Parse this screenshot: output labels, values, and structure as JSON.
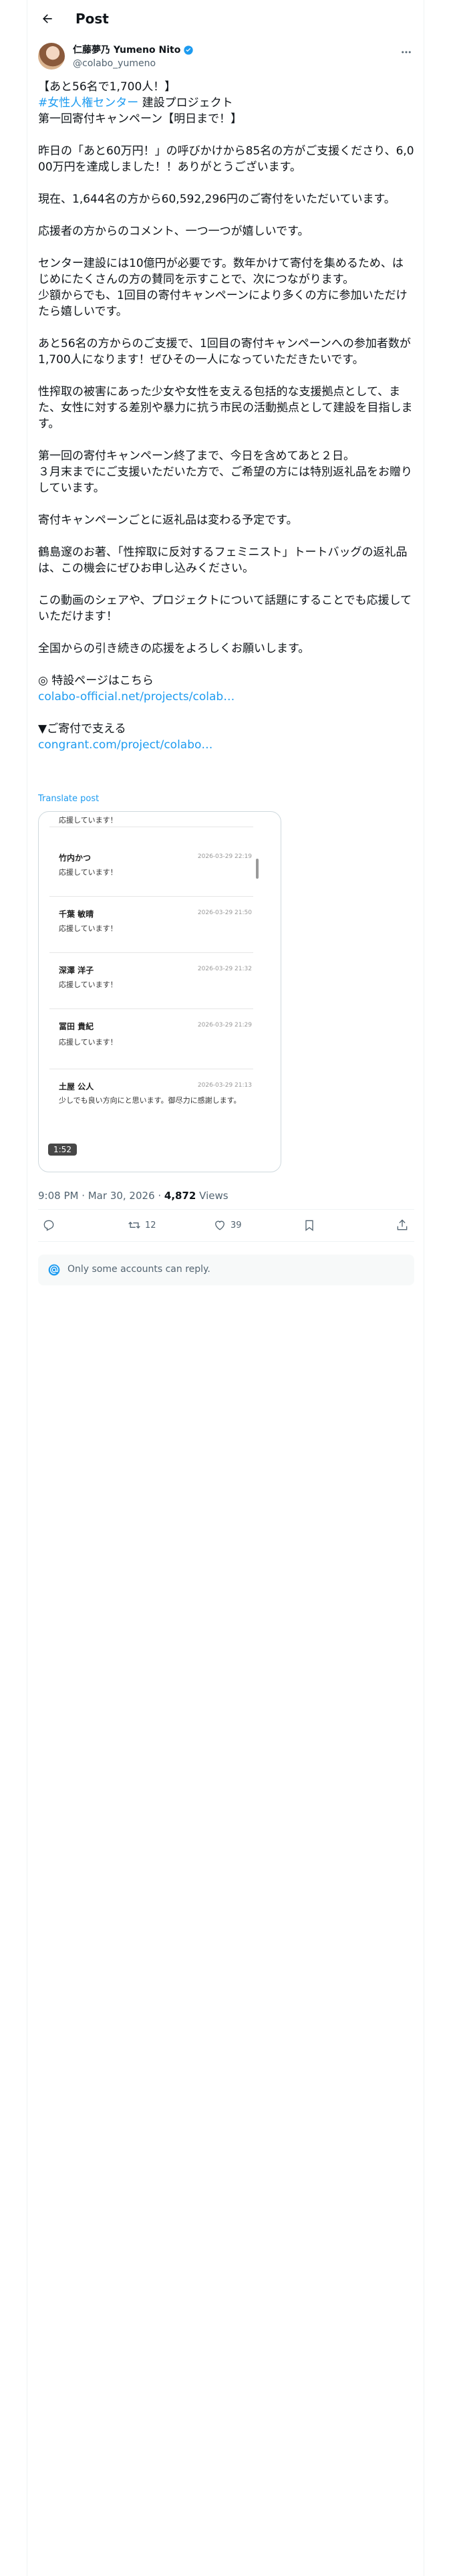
{
  "header": {
    "title": "Post"
  },
  "author": {
    "display_name": "仁藤夢乃 Yumeno Nito",
    "handle": "@colabo_yumeno"
  },
  "post": {
    "lines": [
      "【あと56名で1,700人！】",
      "#女性人権センター",
      " 建設プロジェクト",
      "第一回寄付キャンペーン【明日まで！】",
      "昨日の「あと60万円！」の呼びかけから85名の方がご支援くださり、6,000万円を達成しました！！ありがとうございます。",
      "現在、1,644名の方から60,592,296円のご寄付をいただいています。",
      "応援者の方からのコメント、一つ一つが嬉しいです。",
      "センター建設には10億円が必要です。数年かけて寄付を集めるため、はじめにたくさんの方の賛同を示すことで、次につながります。\n少額からでも、1回目の寄付キャンペーンにより多くの方に参加いただけたら嬉しいです。",
      "あと56名の方からのご支援で、1回目の寄付キャンペーンへの参加者数が1,700人になります！ぜひその一人になっていただきたいです。",
      "性搾取の被害にあった少女や女性を支える包括的な支援拠点として、また、女性に対する差別や暴力に抗う市民の活動拠点として建設を目指します。",
      "第一回の寄付キャンペーン終了まで、今日を含めてあと２日。\n３月末までにご支援いただいた方で、ご希望の方には特別返礼品をお贈りしています。",
      "寄付キャンペーンごとに返礼品は変わる予定です。",
      "鶴島邃のお著、「性搾取に反対するフェミニスト」トートバッグの返礼品は、この機会にぜひお申し込みください。",
      "この動画のシェアや、プロジェクトについて話題にすることでも応援していただけます！",
      "全国からの引き続きの応援をよろしくお願いします。",
      "◎ 特設ページはこちら",
      "colabo-official.net/projects/colab…",
      "▼ご寄付で支える",
      "congrant.com/project/colabo…"
    ],
    "translate": "Translate post"
  },
  "media": {
    "top_msg": "応援しています！",
    "donors": [
      {
        "name": "竹内かつ",
        "date": "2026-03-29 22:19",
        "msg": "応援しています！"
      },
      {
        "name": "千葉 敏晴",
        "date": "2026-03-29 21:50",
        "msg": "応援しています！"
      },
      {
        "name": "深澤 洋子",
        "date": "2026-03-29 21:32",
        "msg": "応援しています！"
      },
      {
        "name": "冨田 貴紀",
        "date": "2026-03-29 21:29",
        "msg": "応援しています！"
      },
      {
        "name": "土屋 公人",
        "date": "2026-03-29 21:13",
        "msg": "少しでも良い方向にと思います。御尽力に感謝します。"
      }
    ],
    "duration": "1:52"
  },
  "meta": {
    "time": "9:08 PM · Mar 30, 2026 · ",
    "views": "4,872",
    "views_label": " Views"
  },
  "actions": {
    "replies": "",
    "reposts": "12",
    "likes": "39"
  },
  "reply_restriction": "Only some accounts can reply.",
  "colors": {
    "link": "#1d9bf0",
    "text": "#0f1419",
    "muted": "#536471"
  }
}
